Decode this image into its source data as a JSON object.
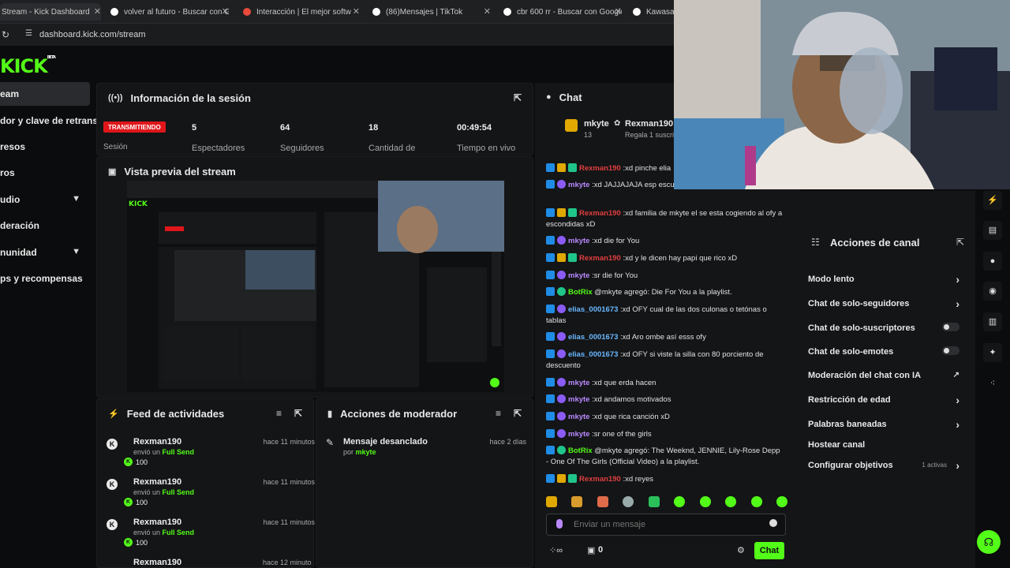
{
  "tabs": [
    {
      "title": "Stream - Kick Dashboard",
      "icon": "kick-icon",
      "color": "#53fc18"
    },
    {
      "title": "volver al futuro - Buscar con Go",
      "icon": "google-icon",
      "color": "#ffffff"
    },
    {
      "title": "Interacción | El mejor softw",
      "icon": "play-icon",
      "color": "#e64a3b"
    },
    {
      "title": "(86)Mensajes | TikTok",
      "icon": "tiktok-icon",
      "color": "#ffffff"
    },
    {
      "title": "cbr 600 rr - Buscar con Google",
      "icon": "google-icon",
      "color": "#ffffff"
    },
    {
      "title": "Kawasaki",
      "icon": "google-icon",
      "color": "#ffffff"
    }
  ],
  "address": {
    "url": "dashboard.kick.com/stream"
  },
  "brand": {
    "logo": "KICK",
    "tag": "BETA",
    "accent": "#53fc18"
  },
  "sidebar": {
    "items": [
      {
        "label": "eam"
      },
      {
        "label": "dor y clave de retransn"
      },
      {
        "label": "resos"
      },
      {
        "label": "ros"
      },
      {
        "label": "udio"
      },
      {
        "label": "deración"
      },
      {
        "label": "nunidad"
      },
      {
        "label": "ps y recompensas"
      }
    ]
  },
  "session": {
    "title": "Información de la sesión",
    "live_badge": "TRANSMITIENDO",
    "session_label": "Sesión",
    "stats": [
      {
        "value": "5",
        "label": "Espectadores"
      },
      {
        "value": "64",
        "label": "Seguidores"
      },
      {
        "value": "18",
        "label": "Cantidad de"
      },
      {
        "value": "00:49:54",
        "label": "Tiempo en vivo"
      }
    ]
  },
  "preview": {
    "title": "Vista previa del stream"
  },
  "activity": {
    "title": "Feed de actividades",
    "items": [
      {
        "user": "Rexman190",
        "time": "hace 11 minutos",
        "action": "envió un",
        "item": "Full Send",
        "amount": "100"
      },
      {
        "user": "Rexman190",
        "time": "hace 11 minutos",
        "action": "envió un",
        "item": "Full Send",
        "amount": "100"
      },
      {
        "user": "Rexman190",
        "time": "hace 11 minutos",
        "action": "envió un",
        "item": "Full Send",
        "amount": "100"
      },
      {
        "user": "Rexman190",
        "time": "hace 12 minutos",
        "action": "",
        "item": "",
        "amount": ""
      }
    ]
  },
  "modactions": {
    "title": "Acciones de moderador",
    "items": [
      {
        "title": "Mensaje desanclado",
        "by_label": "por",
        "by": "mkyte",
        "time": "hace 2 días"
      }
    ]
  },
  "chat": {
    "title": "Chat",
    "pinned": {
      "user": "mkyte",
      "count": "13",
      "gifter": "Rexman190",
      "gift_text": "Regala 1 suscrip"
    },
    "messages": [
      {
        "user": "Rexman190",
        "color": "red",
        "text": ":xd pinche elia"
      },
      {
        "user": "mkyte",
        "color": "purple",
        "text": ":xd JAJJAJAJA esp escuchandote"
      },
      {
        "user": "Rexman190",
        "color": "red",
        "text": ":xd familia de mkyte el se esta cogiendo al ofy a escondidas xD"
      },
      {
        "user": "mkyte",
        "color": "purple",
        "text": ":xd die for You"
      },
      {
        "user": "Rexman190",
        "color": "red",
        "text": ":xd y le dicen hay papi que rico xD"
      },
      {
        "user": "mkyte",
        "color": "purple",
        "text": ":sr die for You"
      },
      {
        "user": "BotRix",
        "color": "green",
        "text": "@mkyte agregó: Die For You a la playlist."
      },
      {
        "user": "elias_0001673",
        "color": "blue",
        "text": ":xd OFY cual de las dos culonas o tetónas o tablas"
      },
      {
        "user": "elias_0001673",
        "color": "blue",
        "text": ":xd Aro ombe así esss ofy"
      },
      {
        "user": "elias_0001673",
        "color": "blue",
        "text": ":xd OFY si viste la silla con 80 porciento de descuento"
      },
      {
        "user": "mkyte",
        "color": "purple",
        "text": ":xd que erda hacen"
      },
      {
        "user": "mkyte",
        "color": "purple",
        "text": ":xd andamos motivados"
      },
      {
        "user": "mkyte",
        "color": "purple",
        "text": ":xd que rica canción xD"
      },
      {
        "user": "mkyte",
        "color": "purple",
        "text": ":sr one of the girls"
      },
      {
        "user": "BotRix",
        "color": "green",
        "text": "@mkyte agregó: The Weeknd, JENNIE, Lily-Rose Depp - One Of The Girls (Official Video) a la playlist."
      },
      {
        "user": "Rexman190",
        "color": "red",
        "text": ":xd reyes"
      }
    ],
    "input_placeholder": "Enviar un mensaje",
    "footer_count": "0",
    "send_label": "Chat"
  },
  "channel_actions": {
    "title": "Acciones de canal",
    "items": [
      {
        "label": "Modo lento",
        "control": "chevron"
      },
      {
        "label": "Chat de solo-seguidores",
        "control": "chevron"
      },
      {
        "label": "Chat de solo-suscriptores",
        "control": "toggle"
      },
      {
        "label": "Chat de solo-emotes",
        "control": "toggle"
      },
      {
        "label": "Moderación del chat con IA",
        "control": "external"
      },
      {
        "label": "Restricción de edad",
        "control": "chevron"
      },
      {
        "label": "Palabras baneadas",
        "control": "chevron"
      },
      {
        "label": "Hostear canal",
        "control": "none"
      },
      {
        "label": "Configurar objetivos",
        "control": "chevron",
        "extra": "1 activas"
      }
    ]
  }
}
